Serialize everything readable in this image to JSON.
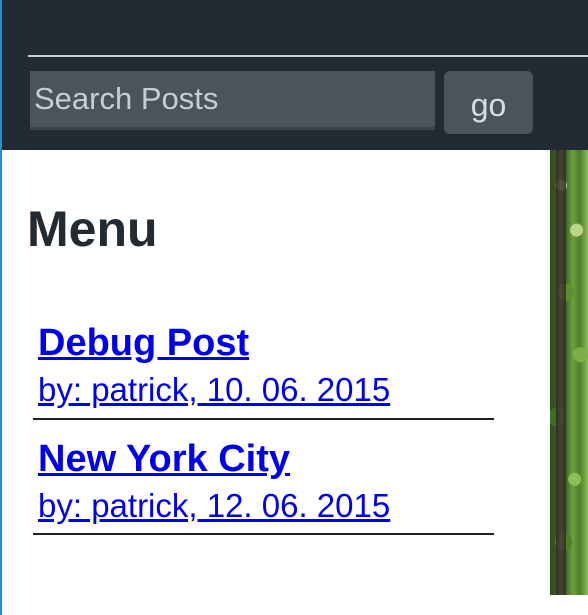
{
  "search": {
    "placeholder": "Search Posts",
    "value": "",
    "go_label": "go"
  },
  "sidebar": {
    "title": "Menu",
    "posts": [
      {
        "title": "Debug Post",
        "meta": "by: patrick, 10. 06. 2015"
      },
      {
        "title": "New York City",
        "meta": "by: patrick, 12. 06. 2015"
      }
    ]
  },
  "colors": {
    "header_bg": "#222b31",
    "input_bg": "#4a545b",
    "link": "#0000ee",
    "heading": "#222b31",
    "left_edge_accent": "#1e90d8"
  }
}
